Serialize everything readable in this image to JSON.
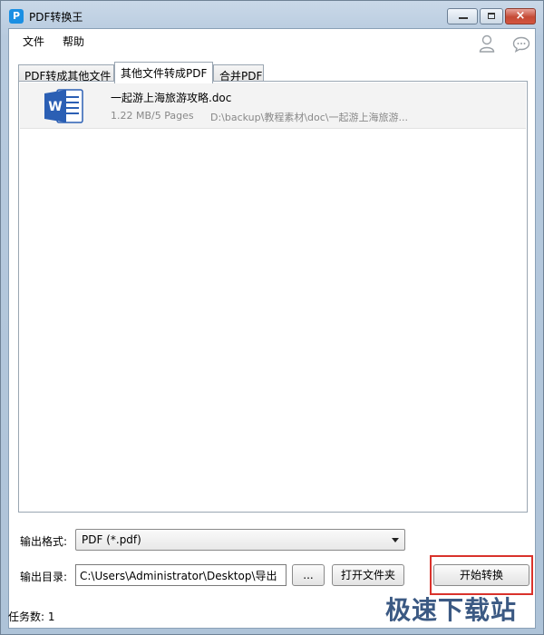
{
  "window": {
    "title": "PDF转换王",
    "app_icon_glyph": "P",
    "close_glyph": "×"
  },
  "menu": {
    "items": [
      "文件",
      "帮助"
    ]
  },
  "tabs": [
    {
      "label": "PDF转成其他文件",
      "active": false
    },
    {
      "label": "其他文件转成PDF",
      "active": true
    },
    {
      "label": "合并PDF",
      "active": false
    }
  ],
  "files": [
    {
      "name": "一起游上海旅游攻略.doc",
      "meta": "1.22 MB/5 Pages",
      "path": "D:\\backup\\教程素材\\doc\\一起游上海旅游..."
    }
  ],
  "output": {
    "format_label": "输出格式:",
    "format_value": "PDF (*.pdf)",
    "dir_label": "输出目录:",
    "dir_value": "C:\\Users\\Administrator\\Desktop\\导出",
    "browse_label": "...",
    "open_folder_label": "打开文件夹",
    "start_label": "开始转换"
  },
  "status": {
    "task_count": "任务数: 1"
  },
  "watermark": "极速下载站",
  "colors": {
    "accent": "#1a8fe3",
    "word_blue": "#2b5fb4",
    "highlight": "#d9322b"
  }
}
